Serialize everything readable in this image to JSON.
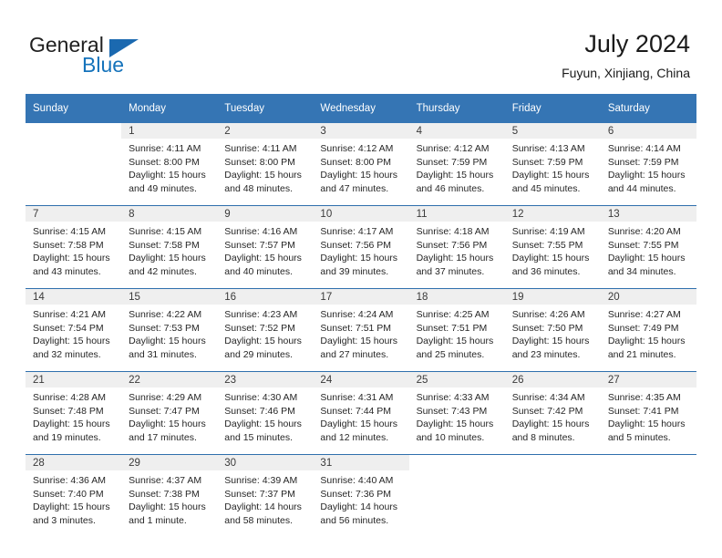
{
  "brand": {
    "name_part1": "General",
    "name_part2": "Blue",
    "accent_color": "#1573bb",
    "triangle_color": "#1b69b0"
  },
  "header": {
    "title": "July 2024",
    "location": "Fuyun, Xinjiang, China"
  },
  "theme": {
    "header_row_bg": "#3575b4",
    "week_divider": "#2f6fad",
    "daynum_band_bg": "#efefef"
  },
  "weekday_headers": [
    "Sunday",
    "Monday",
    "Tuesday",
    "Wednesday",
    "Thursday",
    "Friday",
    "Saturday"
  ],
  "weeks": [
    [
      {
        "day": "",
        "sunrise": "",
        "sunset": "",
        "daylight_line1": "",
        "daylight_line2": "",
        "empty": true
      },
      {
        "day": "1",
        "sunrise": "Sunrise: 4:11 AM",
        "sunset": "Sunset: 8:00 PM",
        "daylight_line1": "Daylight: 15 hours",
        "daylight_line2": "and 49 minutes.",
        "empty": false
      },
      {
        "day": "2",
        "sunrise": "Sunrise: 4:11 AM",
        "sunset": "Sunset: 8:00 PM",
        "daylight_line1": "Daylight: 15 hours",
        "daylight_line2": "and 48 minutes.",
        "empty": false
      },
      {
        "day": "3",
        "sunrise": "Sunrise: 4:12 AM",
        "sunset": "Sunset: 8:00 PM",
        "daylight_line1": "Daylight: 15 hours",
        "daylight_line2": "and 47 minutes.",
        "empty": false
      },
      {
        "day": "4",
        "sunrise": "Sunrise: 4:12 AM",
        "sunset": "Sunset: 7:59 PM",
        "daylight_line1": "Daylight: 15 hours",
        "daylight_line2": "and 46 minutes.",
        "empty": false
      },
      {
        "day": "5",
        "sunrise": "Sunrise: 4:13 AM",
        "sunset": "Sunset: 7:59 PM",
        "daylight_line1": "Daylight: 15 hours",
        "daylight_line2": "and 45 minutes.",
        "empty": false
      },
      {
        "day": "6",
        "sunrise": "Sunrise: 4:14 AM",
        "sunset": "Sunset: 7:59 PM",
        "daylight_line1": "Daylight: 15 hours",
        "daylight_line2": "and 44 minutes.",
        "empty": false
      }
    ],
    [
      {
        "day": "7",
        "sunrise": "Sunrise: 4:15 AM",
        "sunset": "Sunset: 7:58 PM",
        "daylight_line1": "Daylight: 15 hours",
        "daylight_line2": "and 43 minutes.",
        "empty": false
      },
      {
        "day": "8",
        "sunrise": "Sunrise: 4:15 AM",
        "sunset": "Sunset: 7:58 PM",
        "daylight_line1": "Daylight: 15 hours",
        "daylight_line2": "and 42 minutes.",
        "empty": false
      },
      {
        "day": "9",
        "sunrise": "Sunrise: 4:16 AM",
        "sunset": "Sunset: 7:57 PM",
        "daylight_line1": "Daylight: 15 hours",
        "daylight_line2": "and 40 minutes.",
        "empty": false
      },
      {
        "day": "10",
        "sunrise": "Sunrise: 4:17 AM",
        "sunset": "Sunset: 7:56 PM",
        "daylight_line1": "Daylight: 15 hours",
        "daylight_line2": "and 39 minutes.",
        "empty": false
      },
      {
        "day": "11",
        "sunrise": "Sunrise: 4:18 AM",
        "sunset": "Sunset: 7:56 PM",
        "daylight_line1": "Daylight: 15 hours",
        "daylight_line2": "and 37 minutes.",
        "empty": false
      },
      {
        "day": "12",
        "sunrise": "Sunrise: 4:19 AM",
        "sunset": "Sunset: 7:55 PM",
        "daylight_line1": "Daylight: 15 hours",
        "daylight_line2": "and 36 minutes.",
        "empty": false
      },
      {
        "day": "13",
        "sunrise": "Sunrise: 4:20 AM",
        "sunset": "Sunset: 7:55 PM",
        "daylight_line1": "Daylight: 15 hours",
        "daylight_line2": "and 34 minutes.",
        "empty": false
      }
    ],
    [
      {
        "day": "14",
        "sunrise": "Sunrise: 4:21 AM",
        "sunset": "Sunset: 7:54 PM",
        "daylight_line1": "Daylight: 15 hours",
        "daylight_line2": "and 32 minutes.",
        "empty": false
      },
      {
        "day": "15",
        "sunrise": "Sunrise: 4:22 AM",
        "sunset": "Sunset: 7:53 PM",
        "daylight_line1": "Daylight: 15 hours",
        "daylight_line2": "and 31 minutes.",
        "empty": false
      },
      {
        "day": "16",
        "sunrise": "Sunrise: 4:23 AM",
        "sunset": "Sunset: 7:52 PM",
        "daylight_line1": "Daylight: 15 hours",
        "daylight_line2": "and 29 minutes.",
        "empty": false
      },
      {
        "day": "17",
        "sunrise": "Sunrise: 4:24 AM",
        "sunset": "Sunset: 7:51 PM",
        "daylight_line1": "Daylight: 15 hours",
        "daylight_line2": "and 27 minutes.",
        "empty": false
      },
      {
        "day": "18",
        "sunrise": "Sunrise: 4:25 AM",
        "sunset": "Sunset: 7:51 PM",
        "daylight_line1": "Daylight: 15 hours",
        "daylight_line2": "and 25 minutes.",
        "empty": false
      },
      {
        "day": "19",
        "sunrise": "Sunrise: 4:26 AM",
        "sunset": "Sunset: 7:50 PM",
        "daylight_line1": "Daylight: 15 hours",
        "daylight_line2": "and 23 minutes.",
        "empty": false
      },
      {
        "day": "20",
        "sunrise": "Sunrise: 4:27 AM",
        "sunset": "Sunset: 7:49 PM",
        "daylight_line1": "Daylight: 15 hours",
        "daylight_line2": "and 21 minutes.",
        "empty": false
      }
    ],
    [
      {
        "day": "21",
        "sunrise": "Sunrise: 4:28 AM",
        "sunset": "Sunset: 7:48 PM",
        "daylight_line1": "Daylight: 15 hours",
        "daylight_line2": "and 19 minutes.",
        "empty": false
      },
      {
        "day": "22",
        "sunrise": "Sunrise: 4:29 AM",
        "sunset": "Sunset: 7:47 PM",
        "daylight_line1": "Daylight: 15 hours",
        "daylight_line2": "and 17 minutes.",
        "empty": false
      },
      {
        "day": "23",
        "sunrise": "Sunrise: 4:30 AM",
        "sunset": "Sunset: 7:46 PM",
        "daylight_line1": "Daylight: 15 hours",
        "daylight_line2": "and 15 minutes.",
        "empty": false
      },
      {
        "day": "24",
        "sunrise": "Sunrise: 4:31 AM",
        "sunset": "Sunset: 7:44 PM",
        "daylight_line1": "Daylight: 15 hours",
        "daylight_line2": "and 12 minutes.",
        "empty": false
      },
      {
        "day": "25",
        "sunrise": "Sunrise: 4:33 AM",
        "sunset": "Sunset: 7:43 PM",
        "daylight_line1": "Daylight: 15 hours",
        "daylight_line2": "and 10 minutes.",
        "empty": false
      },
      {
        "day": "26",
        "sunrise": "Sunrise: 4:34 AM",
        "sunset": "Sunset: 7:42 PM",
        "daylight_line1": "Daylight: 15 hours",
        "daylight_line2": "and 8 minutes.",
        "empty": false
      },
      {
        "day": "27",
        "sunrise": "Sunrise: 4:35 AM",
        "sunset": "Sunset: 7:41 PM",
        "daylight_line1": "Daylight: 15 hours",
        "daylight_line2": "and 5 minutes.",
        "empty": false
      }
    ],
    [
      {
        "day": "28",
        "sunrise": "Sunrise: 4:36 AM",
        "sunset": "Sunset: 7:40 PM",
        "daylight_line1": "Daylight: 15 hours",
        "daylight_line2": "and 3 minutes.",
        "empty": false
      },
      {
        "day": "29",
        "sunrise": "Sunrise: 4:37 AM",
        "sunset": "Sunset: 7:38 PM",
        "daylight_line1": "Daylight: 15 hours",
        "daylight_line2": "and 1 minute.",
        "empty": false
      },
      {
        "day": "30",
        "sunrise": "Sunrise: 4:39 AM",
        "sunset": "Sunset: 7:37 PM",
        "daylight_line1": "Daylight: 14 hours",
        "daylight_line2": "and 58 minutes.",
        "empty": false
      },
      {
        "day": "31",
        "sunrise": "Sunrise: 4:40 AM",
        "sunset": "Sunset: 7:36 PM",
        "daylight_line1": "Daylight: 14 hours",
        "daylight_line2": "and 56 minutes.",
        "empty": false
      },
      {
        "day": "",
        "sunrise": "",
        "sunset": "",
        "daylight_line1": "",
        "daylight_line2": "",
        "empty": true
      },
      {
        "day": "",
        "sunrise": "",
        "sunset": "",
        "daylight_line1": "",
        "daylight_line2": "",
        "empty": true
      },
      {
        "day": "",
        "sunrise": "",
        "sunset": "",
        "daylight_line1": "",
        "daylight_line2": "",
        "empty": true
      }
    ]
  ]
}
